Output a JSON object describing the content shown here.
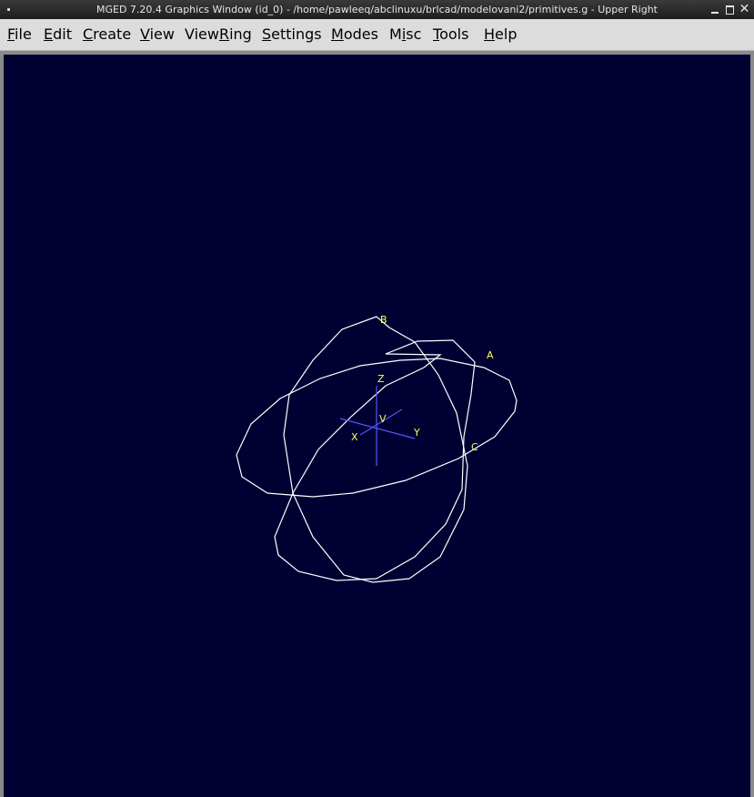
{
  "window": {
    "title": "MGED 7.20.4 Graphics Window (id_0) - /home/pawleeq/abclinuxu/brlcad/modelovani2/primitives.g - Upper Right",
    "close_glyph": "✕"
  },
  "menu": {
    "items": [
      {
        "mnemonic": "F",
        "rest": "ile"
      },
      {
        "mnemonic": "E",
        "rest": "dit"
      },
      {
        "mnemonic": "C",
        "rest": "reate"
      },
      {
        "mnemonic": "V",
        "rest": "iew"
      },
      {
        "pre": "View",
        "mnemonic": "R",
        "rest": "ing"
      },
      {
        "mnemonic": "S",
        "rest": "ettings"
      },
      {
        "mnemonic": "M",
        "rest": "odes"
      },
      {
        "pre": "M",
        "mnemonic": "i",
        "rest": "sc"
      },
      {
        "mnemonic": "T",
        "rest": "ools"
      },
      {
        "mnemonic": "H",
        "rest": "elp"
      }
    ]
  },
  "viewport": {
    "background": "#000033",
    "wire_color": "#ffffff",
    "axis_color": "#5555ff",
    "label_color": "#ffff55",
    "axis_labels": {
      "x": "X",
      "y": "Y",
      "z": "Z",
      "vertex": "V"
    },
    "vertex_labels": {
      "a": "A",
      "b": "B",
      "c": "C"
    }
  }
}
